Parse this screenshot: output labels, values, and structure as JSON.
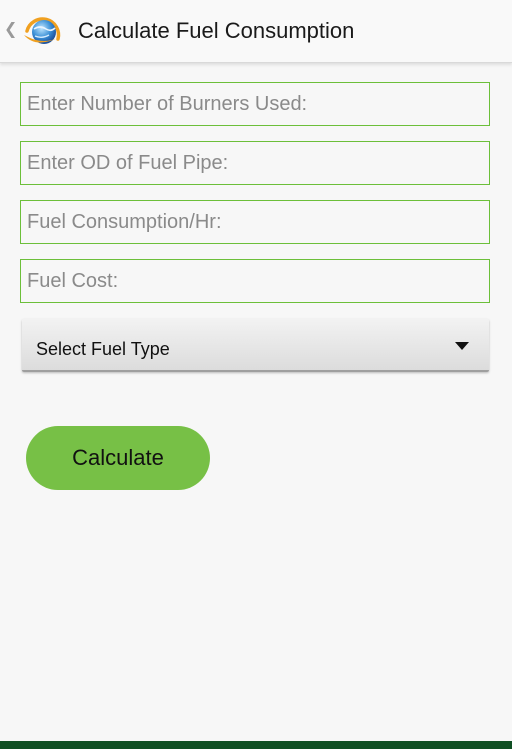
{
  "action_bar": {
    "title": "Calculate Fuel Consumption",
    "up_icon": "chevron-left-icon",
    "logo_icon": "globe-swoosh-logo-icon"
  },
  "form": {
    "burners_placeholder": "Enter Number of Burners Used:",
    "burners_value": "",
    "od_placeholder": "Enter OD of Fuel Pipe:",
    "od_value": "",
    "consumption_placeholder": "Fuel Consumption/Hr:",
    "consumption_value": "",
    "cost_placeholder": "Fuel Cost:",
    "cost_value": "",
    "fuel_type_selected": "Select Fuel Type",
    "dropdown_icon": "triangle-down-icon"
  },
  "actions": {
    "calculate_label": "Calculate"
  },
  "colors": {
    "field_border": "#6cbf3a",
    "button_bg": "#77c046",
    "bottom_bar": "#0f4f23",
    "background": "#f7f7f7"
  }
}
